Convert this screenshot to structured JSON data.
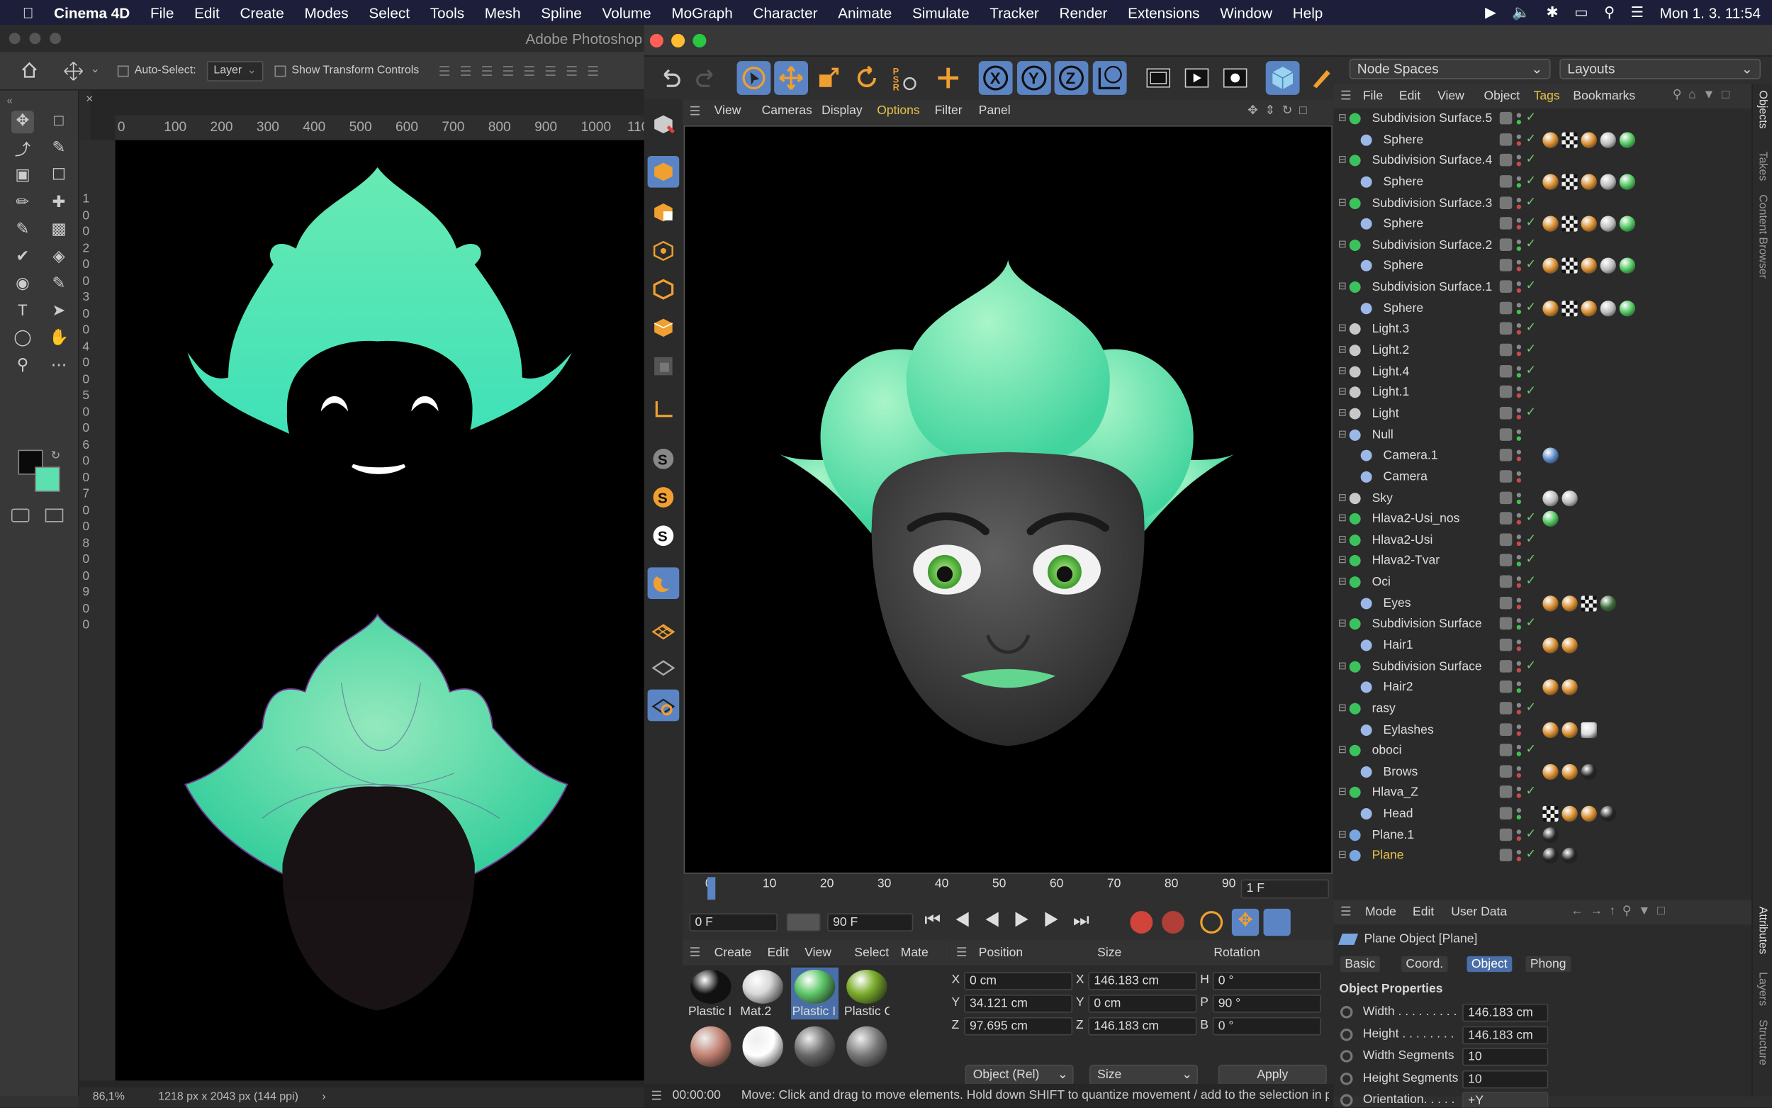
{
  "menubar": {
    "app": "Cinema 4D",
    "items": [
      "File",
      "Edit",
      "Create",
      "Modes",
      "Select",
      "Tools",
      "Mesh",
      "Spline",
      "Volume",
      "MoGraph",
      "Character",
      "Animate",
      "Simulate",
      "Tracker",
      "Render",
      "Extensions",
      "Window",
      "Help"
    ],
    "datetime": "Mon 1. 3.  11:54"
  },
  "photoshop": {
    "title": "Adobe Photoshop",
    "options": {
      "auto_select_label": "Auto-Select:",
      "layer_value": "Layer",
      "transform_label": "Show Transform Controls"
    },
    "ruler_h": [
      "0",
      "100",
      "200",
      "300",
      "400",
      "500",
      "600",
      "700",
      "800",
      "900",
      "1000",
      "110"
    ],
    "ruler_v": [
      "1",
      "0",
      "0",
      "2",
      "0",
      "0",
      "3",
      "0",
      "0",
      "4",
      "0",
      "0",
      "5",
      "0",
      "0",
      "6",
      "0",
      "0",
      "7",
      "0",
      "0",
      "8",
      "0",
      "0",
      "9",
      "0",
      "0"
    ],
    "status": {
      "zoom": "86,1%",
      "doc": "1218 px x 2043 px (144 ppi)"
    },
    "colors": {
      "fg": "#0a0a0a",
      "bg": "#5de0b0",
      "leaf": "#5ee8b5"
    }
  },
  "c4d": {
    "top": {
      "node_spaces": "Node Spaces",
      "layouts": "Layouts"
    },
    "viewport_menu": [
      "View",
      "Cameras",
      "Display",
      "Options",
      "Filter",
      "Panel"
    ],
    "timeline": {
      "ticks": [
        "0",
        "10",
        "20",
        "30",
        "40",
        "50",
        "60",
        "70",
        "80",
        "90"
      ],
      "frame_field": "1 F"
    },
    "anim": {
      "start": "0 F",
      "end": "90 F"
    },
    "matmgr": {
      "menu": [
        "Create",
        "Edit",
        "View",
        "Select",
        "Mate"
      ],
      "materials": [
        "Plastic I",
        "Mat.2",
        "Plastic I",
        "Plastic C"
      ]
    },
    "coord": {
      "headers": [
        "Position",
        "Size",
        "Rotation"
      ],
      "pos": [
        {
          "axis": "X",
          "value": "0 cm"
        },
        {
          "axis": "Y",
          "value": "34.121 cm"
        },
        {
          "axis": "Z",
          "value": "97.695 cm"
        }
      ],
      "size": [
        {
          "axis": "X",
          "value": "146.183 cm"
        },
        {
          "axis": "Y",
          "value": "0 cm"
        },
        {
          "axis": "Z",
          "value": "146.183 cm"
        }
      ],
      "rot": [
        {
          "axis": "H",
          "value": "0 °"
        },
        {
          "axis": "P",
          "value": "90 °"
        },
        {
          "axis": "B",
          "value": "0 °"
        }
      ],
      "mode": "Object (Rel)",
      "size_mode": "Size",
      "apply": "Apply"
    },
    "status": {
      "time": "00:00:00",
      "message": "Move: Click and drag to move elements. Hold down SHIFT to quantize movement / add to the selection in p"
    },
    "object_manager": {
      "menu": [
        "File",
        "Edit",
        "View",
        "Object",
        "Tags",
        "Bookmarks"
      ],
      "rows": [
        {
          "name": "Subdivision Surface.5",
          "indent": 0
        },
        {
          "name": "Sphere",
          "indent": 1
        },
        {
          "name": "Subdivision Surface.4",
          "indent": 0
        },
        {
          "name": "Sphere",
          "indent": 1
        },
        {
          "name": "Subdivision Surface.3",
          "indent": 0
        },
        {
          "name": "Sphere",
          "indent": 1
        },
        {
          "name": "Subdivision Surface.2",
          "indent": 0
        },
        {
          "name": "Sphere",
          "indent": 1
        },
        {
          "name": "Subdivision Surface.1",
          "indent": 0
        },
        {
          "name": "Sphere",
          "indent": 1
        },
        {
          "name": "Light.3",
          "indent": 0
        },
        {
          "name": "Light.2",
          "indent": 0
        },
        {
          "name": "Light.4",
          "indent": 0
        },
        {
          "name": "Light.1",
          "indent": 0
        },
        {
          "name": "Light",
          "indent": 0
        },
        {
          "name": "Null",
          "indent": 0
        },
        {
          "name": "Camera.1",
          "indent": 1
        },
        {
          "name": "Camera",
          "indent": 1
        },
        {
          "name": "Sky",
          "indent": 0
        },
        {
          "name": "Hlava2-Usi_nos",
          "indent": 0
        },
        {
          "name": "Hlava2-Usi",
          "indent": 0
        },
        {
          "name": "Hlava2-Tvar",
          "indent": 0
        },
        {
          "name": "Oci",
          "indent": 0
        },
        {
          "name": "Eyes",
          "indent": 1
        },
        {
          "name": "Subdivision Surface",
          "indent": 0
        },
        {
          "name": "Hair1",
          "indent": 1
        },
        {
          "name": "Subdivision Surface",
          "indent": 0
        },
        {
          "name": "Hair2",
          "indent": 1
        },
        {
          "name": "rasy",
          "indent": 0
        },
        {
          "name": "Eylashes",
          "indent": 1
        },
        {
          "name": "oboci",
          "indent": 0
        },
        {
          "name": "Brows",
          "indent": 1
        },
        {
          "name": "Hlava_Z",
          "indent": 0
        },
        {
          "name": "Head",
          "indent": 1
        },
        {
          "name": "Plane.1",
          "indent": 0
        },
        {
          "name": "Plane",
          "indent": 0,
          "selected": true
        }
      ]
    },
    "side_tabs": [
      "Objects",
      "Takes",
      "Content Browser"
    ],
    "attr_tabs": [
      "Attributes",
      "Layers",
      "Structure"
    ],
    "attributes": {
      "menu": [
        "Mode",
        "Edit",
        "User Data"
      ],
      "object_title": "Plane Object [Plane]",
      "tabs": [
        "Basic",
        "Coord.",
        "Object",
        "Phong"
      ],
      "section": "Object Properties",
      "props": [
        {
          "label": "Width . . . . . . . . .",
          "value": "146.183 cm"
        },
        {
          "label": "Height . . . . . . . .",
          "value": "146.183 cm"
        },
        {
          "label": "Width Segments",
          "value": "10"
        },
        {
          "label": "Height Segments",
          "value": "10"
        },
        {
          "label": "Orientation. . . . .",
          "value": "+Y"
        }
      ]
    }
  }
}
